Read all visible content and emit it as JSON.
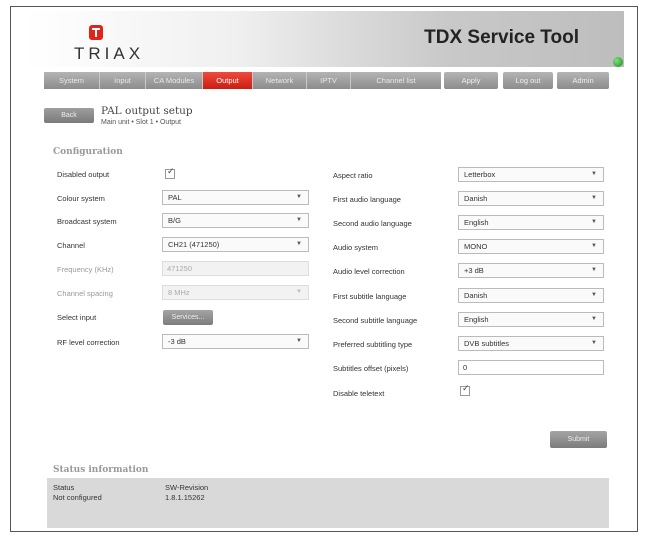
{
  "app": {
    "logo_text": "TRIAX",
    "title": "TDX Service Tool"
  },
  "nav": {
    "tabs": [
      {
        "label": "System"
      },
      {
        "label": "Input"
      },
      {
        "label": "CA Modules"
      },
      {
        "label": "Output"
      },
      {
        "label": "Network"
      },
      {
        "label": "IPTV"
      },
      {
        "label": "Channel list"
      }
    ],
    "active_tab": "Output",
    "apply": "Apply",
    "logout": "Log out",
    "admin": "Admin"
  },
  "page": {
    "back": "Back",
    "title": "PAL output setup",
    "breadcrumb": "Main unit • Slot 1 • Output"
  },
  "config": {
    "section_title": "Configuration",
    "disabled_output": {
      "label": "Disabled output",
      "checked": true
    },
    "colour_system": {
      "label": "Colour system",
      "value": "PAL"
    },
    "broadcast_system": {
      "label": "Broadcast system",
      "value": "B/G"
    },
    "channel": {
      "label": "Channel",
      "value": "CH21 (471250)"
    },
    "frequency": {
      "label": "Frequency (KHz)",
      "value": "471250"
    },
    "channel_spacing": {
      "label": "Channel spacing",
      "value": "8 MHz"
    },
    "select_input": {
      "label": "Select input",
      "button": "Services..."
    },
    "rf_level": {
      "label": "RF level correction",
      "value": "-3 dB"
    },
    "aspect_ratio": {
      "label": "Aspect ratio",
      "value": "Letterbox"
    },
    "first_audio": {
      "label": "First audio language",
      "value": "Danish"
    },
    "second_audio": {
      "label": "Second audio language",
      "value": "English"
    },
    "audio_system": {
      "label": "Audio system",
      "value": "MONO"
    },
    "audio_level": {
      "label": "Audio level correction",
      "value": "+3 dB"
    },
    "first_subtitle": {
      "label": "First subtitle language",
      "value": "Danish"
    },
    "second_subtitle": {
      "label": "Second subtitle language",
      "value": "English"
    },
    "preferred_subtitling": {
      "label": "Preferred subtitling type",
      "value": "DVB subtitles"
    },
    "subtitles_offset": {
      "label": "Subtitles offset (pixels)",
      "value": "0"
    },
    "disable_teletext": {
      "label": "Disable teletext",
      "checked": true
    },
    "submit": "Submit"
  },
  "status": {
    "section_title": "Status information",
    "col1_header": "Status",
    "col1_value": "Not configured",
    "col2_header": "SW-Revision",
    "col2_value": "1.8.1.15262"
  },
  "colors": {
    "accent": "#d9261c",
    "led": "#2ea52e"
  }
}
